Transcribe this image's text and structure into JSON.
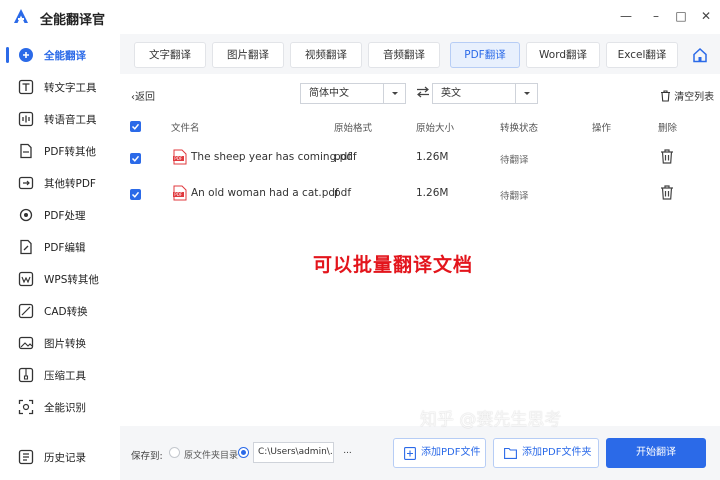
{
  "app": {
    "title": "全能翻译官"
  },
  "window": {
    "minimize": "—",
    "restore": "□",
    "close": "✕"
  },
  "sidebar": {
    "items": [
      {
        "label": "全能翻译",
        "icon": "translate-icon",
        "active": true
      },
      {
        "label": "转文字工具",
        "icon": "text-icon"
      },
      {
        "label": "转语音工具",
        "icon": "voice-icon"
      },
      {
        "label": "PDF转其他",
        "icon": "pdf-convert-icon"
      },
      {
        "label": "其他转PDF",
        "icon": "to-pdf-icon"
      },
      {
        "label": "PDF处理",
        "icon": "pdf-process-icon"
      },
      {
        "label": "PDF编辑",
        "icon": "pdf-edit-icon"
      },
      {
        "label": "WPS转其他",
        "icon": "wps-icon"
      },
      {
        "label": "CAD转换",
        "icon": "cad-icon"
      },
      {
        "label": "图片转换",
        "icon": "image-icon"
      },
      {
        "label": "压缩工具",
        "icon": "compress-icon"
      },
      {
        "label": "全能识别",
        "icon": "scan-icon"
      },
      {
        "label": "历史记录",
        "icon": "history-icon"
      }
    ]
  },
  "tabs": [
    {
      "label": "文字翻译"
    },
    {
      "label": "图片翻译"
    },
    {
      "label": "视频翻译"
    },
    {
      "label": "音频翻译"
    },
    {
      "label": "PDF翻译",
      "active": true
    },
    {
      "label": "Word翻译"
    },
    {
      "label": "Excel翻译"
    }
  ],
  "toolbar": {
    "back": "返回",
    "source_lang": "简体中文",
    "target_lang": "英文",
    "clear_list": "清空列表"
  },
  "table": {
    "headers": [
      "文件名",
      "原始格式",
      "原始大小",
      "转换状态",
      "操作",
      "删除"
    ],
    "rows": [
      {
        "name": "The sheep year has coming.pdf",
        "format": "pdf",
        "size": "1.26M",
        "status": "待翻译"
      },
      {
        "name": "An old woman had a cat.pdf",
        "format": "pdf",
        "size": "1.26M",
        "status": "待翻译"
      }
    ]
  },
  "annotation": "可以批量翻译文档",
  "footer": {
    "save_to": "保存到:",
    "option_original": "原文件夹目录",
    "path": "C:\\Users\\admin\\...",
    "path_btn": "...",
    "add_pdf": "添加PDF文件",
    "add_folder": "添加PDF文件夹",
    "start": "开始翻译"
  },
  "watermark": "知乎 @赛先生思考",
  "colors": {
    "accent": "#2b6ae8",
    "annotation": "#e3151c"
  }
}
